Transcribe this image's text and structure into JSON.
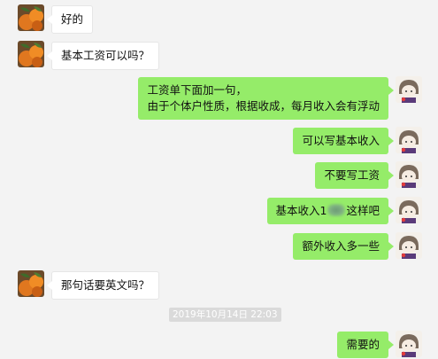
{
  "messages": [
    {
      "side": "in",
      "avatar": "orange-avatar-icon",
      "lines": [
        "好的"
      ]
    },
    {
      "side": "in",
      "avatar": "orange-avatar-icon",
      "lines": [
        "基本工资可以吗？"
      ]
    },
    {
      "side": "out",
      "avatar": "cartoon-girl-avatar-icon",
      "lines": [
        "工资单下面加一句，",
        "由于个体户性质，根据收成，每月收入会有浮动"
      ]
    },
    {
      "side": "out",
      "avatar": "cartoon-girl-avatar-icon",
      "lines": [
        "可以写基本收入"
      ]
    },
    {
      "side": "out",
      "avatar": "cartoon-girl-avatar-icon",
      "lines": [
        "不要写工资"
      ]
    },
    {
      "side": "out",
      "avatar": "cartoon-girl-avatar-icon",
      "text_before": "基本收入1",
      "text_after": "这样吧",
      "redacted": true
    },
    {
      "side": "out",
      "avatar": "cartoon-girl-avatar-icon",
      "lines": [
        "额外收入多一些"
      ]
    },
    {
      "side": "in",
      "avatar": "orange-avatar-icon",
      "lines": [
        "那句话要英文吗？"
      ]
    },
    {
      "side": "out",
      "avatar": "cartoon-girl-avatar-icon",
      "lines": [
        "需要的"
      ]
    }
  ],
  "timestamp": "2019年10月14日 22:03",
  "colors": {
    "background": "#f3f3f3",
    "incoming_bubble": "#ffffff",
    "outgoing_bubble": "#95ec69",
    "timestamp_bg": "#dadada"
  }
}
